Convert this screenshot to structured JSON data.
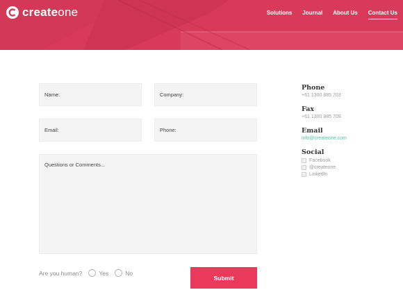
{
  "brand": {
    "name_bold": "create",
    "name_thin": "one"
  },
  "nav": {
    "items": [
      {
        "label": "Solutions",
        "active": false
      },
      {
        "label": "Journal",
        "active": false
      },
      {
        "label": "About Us",
        "active": false
      },
      {
        "label": "Contact Us",
        "active": true
      }
    ]
  },
  "form": {
    "name_placeholder": "Name:",
    "company_placeholder": "Company:",
    "email_placeholder": "Email:",
    "phone_placeholder": "Phone:",
    "comments_placeholder": "Questions or Comments...",
    "human_label": "Are you human?",
    "yes_label": "Yes",
    "no_label": "No",
    "submit_label": "Submit"
  },
  "contact": {
    "phone_heading": "Phone",
    "phone": "+61 1300 885 703",
    "fax_heading": "Fax",
    "fax": "+61 1300 885 709",
    "email_heading": "Email",
    "email": "info@createone.com",
    "social_heading": "Social",
    "social": [
      "Facebook",
      "@createone",
      "LinkedIn"
    ]
  },
  "colors": {
    "accent": "#ea3a5c",
    "hero": "#d83a5a",
    "link": "#53bfa4"
  }
}
